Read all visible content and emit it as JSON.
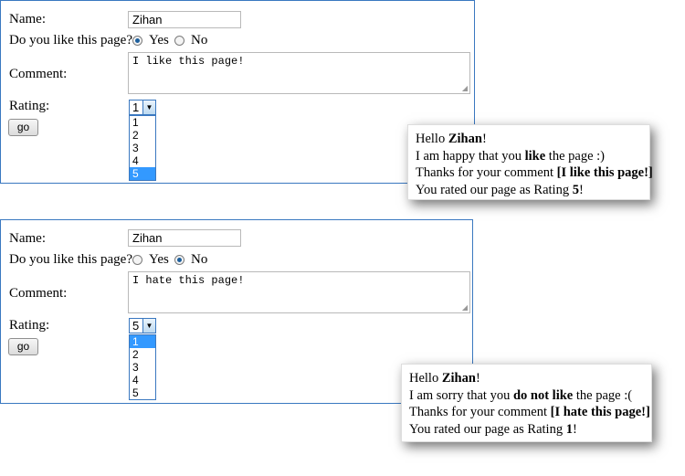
{
  "form1": {
    "name_label": "Name:",
    "name_value": "Zihan",
    "like_label": "Do you like this page?",
    "yes_label": "Yes",
    "no_label": "No",
    "selected": "yes",
    "comment_label": "Comment:",
    "comment_value": "I like this page!",
    "rating_label": "Rating:",
    "rating_value": "1",
    "options": [
      "1",
      "2",
      "3",
      "4",
      "5"
    ],
    "highlighted_option": "5",
    "go_label": "go"
  },
  "result1": {
    "hello": "Hello ",
    "name": "Zihan",
    "excl": "!",
    "line2_pre": "I am happy that you ",
    "line2_bold": "like",
    "line2_post": " the page :)",
    "line3_pre": "Thanks for your comment ",
    "line3_bold": "[I like this page!]",
    "line4_pre": "You rated our page as Rating ",
    "line4_bold": "5",
    "line4_post": "!"
  },
  "form2": {
    "name_label": "Name:",
    "name_value": "Zihan",
    "like_label": "Do you like this page?",
    "yes_label": "Yes",
    "no_label": "No",
    "selected": "no",
    "comment_label": "Comment:",
    "comment_value": "I hate this page!",
    "rating_label": "Rating:",
    "rating_value": "5",
    "options": [
      "1",
      "2",
      "3",
      "4",
      "5"
    ],
    "highlighted_option": "1",
    "go_label": "go"
  },
  "result2": {
    "hello": "Hello ",
    "name": "Zihan",
    "excl": "!",
    "line2_pre": "I am sorry that you ",
    "line2_bold": "do not like",
    "line2_post": " the page :(",
    "line3_pre": "Thanks for your comment ",
    "line3_bold": "[I hate this page!]",
    "line4_pre": "You rated our page as Rating ",
    "line4_bold": "1",
    "line4_post": "!"
  },
  "colors": {
    "panel_border": "#3a78c0",
    "selected_option": "#3399ff",
    "radio_dot": "#1d5f9c"
  }
}
